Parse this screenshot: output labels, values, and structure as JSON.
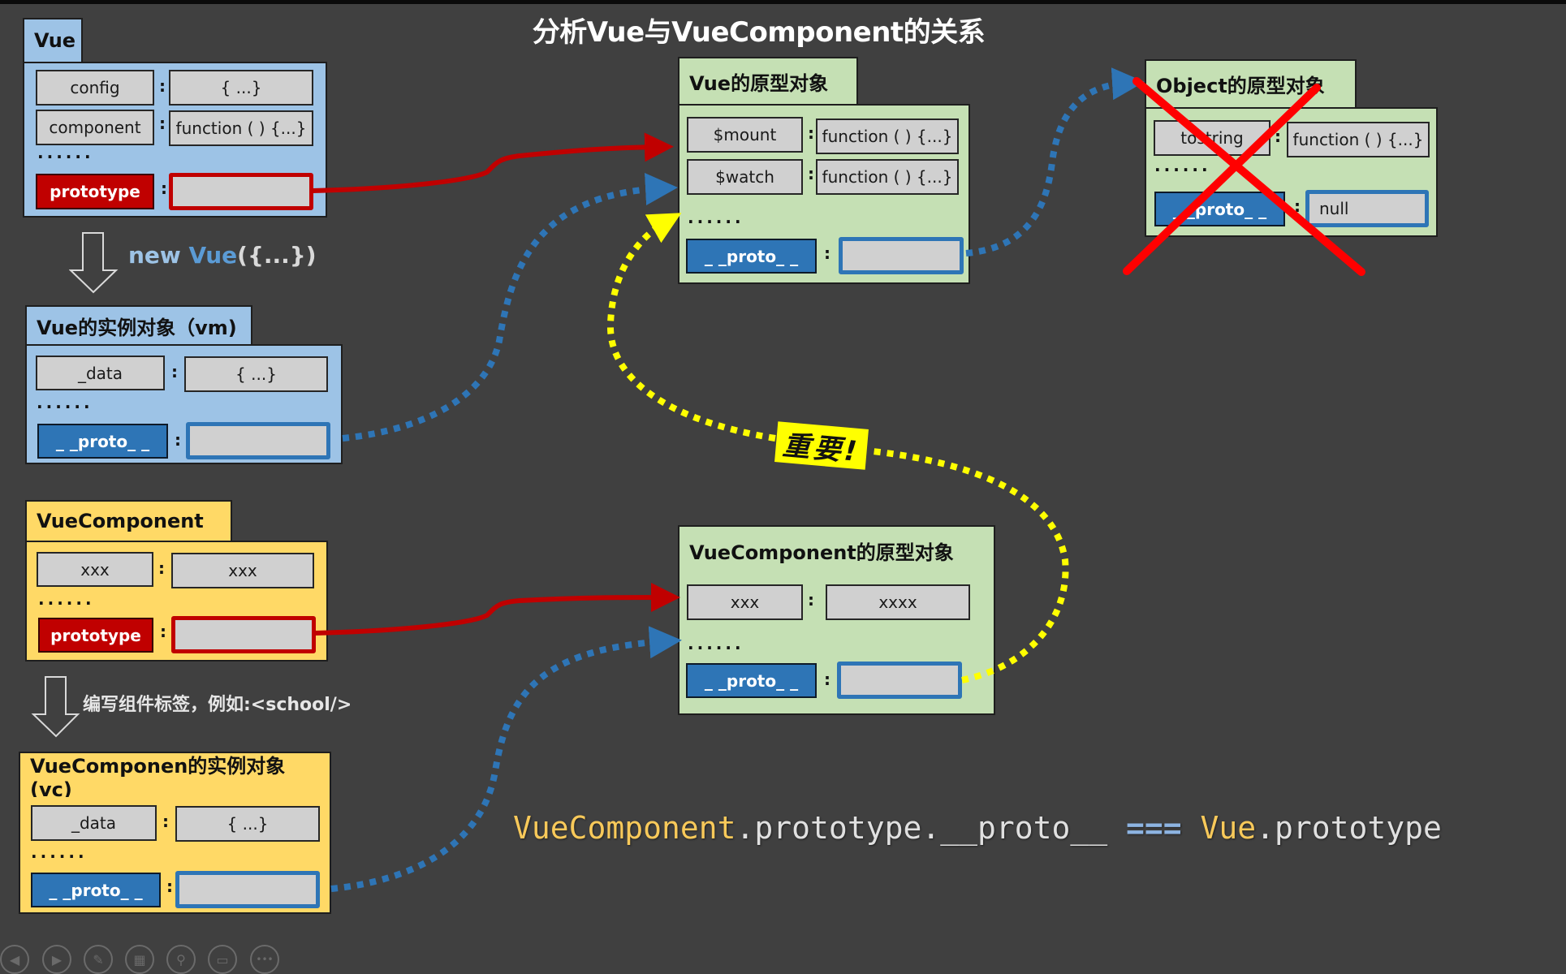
{
  "title": "分析Vue与VueComponent的关系",
  "vue": {
    "header": "Vue",
    "rows": [
      {
        "key": "config",
        "value": "{ ...}"
      },
      {
        "key": "component",
        "value": "function ( ) {...}"
      }
    ],
    "ellipsis": "......",
    "prototype_key": "prototype",
    "prototype_value": ""
  },
  "new_vue": {
    "new": "new ",
    "vue": "Vue",
    "args": "({...})"
  },
  "vm": {
    "header": "Vue的实例对象（vm)",
    "rows": [
      {
        "key": "_data",
        "value": "{ ...}"
      }
    ],
    "ellipsis": "......",
    "proto_key": "_ _proto_ _",
    "proto_value": ""
  },
  "vue_component": {
    "header": "VueComponent",
    "rows": [
      {
        "key": "xxx",
        "value": "xxx"
      }
    ],
    "ellipsis": "......",
    "prototype_key": "prototype",
    "prototype_value": ""
  },
  "write_tag": "编写组件标签，例如:<school/>",
  "vc": {
    "header": "VueComponen的实例对象(vc)",
    "rows": [
      {
        "key": "_data",
        "value": "{ ...}"
      }
    ],
    "ellipsis": "......",
    "proto_key": "_ _proto_ _",
    "proto_value": ""
  },
  "vue_proto": {
    "header": "Vue的原型对象",
    "rows": [
      {
        "key": "$mount",
        "value": "function ( ) {...}"
      },
      {
        "key": "$watch",
        "value": "function ( ) {...}"
      }
    ],
    "ellipsis": "......",
    "proto_key": "_ _proto_ _",
    "proto_value": ""
  },
  "object_proto": {
    "header": "Object的原型对象",
    "rows": [
      {
        "key": "tostring",
        "value": "function ( ) {...}"
      }
    ],
    "ellipsis": "......",
    "proto_key": "_ _proto_ _",
    "proto_value": "null",
    "crossed_out": true
  },
  "vc_proto": {
    "header": "VueComponent的原型对象",
    "rows": [
      {
        "key": "xxx",
        "value": "xxxx"
      }
    ],
    "ellipsis": "......",
    "proto_key": "_ _proto_ _",
    "proto_value": ""
  },
  "important_label": "重要!",
  "equation": {
    "part1": "VueComponent",
    "part2": ".prototype.__proto__ ",
    "op": "===",
    "part3": " Vue",
    "part4": ".prototype"
  },
  "colors": {
    "instance_blue": "#9dc3e6",
    "component_yellow": "#ffd966",
    "prototype_green": "#c5e0b4",
    "prototype_link_red": "#c00000",
    "proto_link_blue": "#2e75b6",
    "important_yellow": "#ffff00",
    "cross_red": "#ff0000"
  },
  "toolbar": [
    {
      "icon": "previous-slide-icon",
      "glyph": "◀"
    },
    {
      "icon": "next-slide-icon",
      "glyph": "▶"
    },
    {
      "icon": "pen-icon",
      "glyph": "✎"
    },
    {
      "icon": "slides-overview-icon",
      "glyph": "▦"
    },
    {
      "icon": "zoom-icon",
      "glyph": "⚲"
    },
    {
      "icon": "subtitles-icon",
      "glyph": "▭"
    },
    {
      "icon": "more-options-icon",
      "glyph": "•••"
    }
  ]
}
